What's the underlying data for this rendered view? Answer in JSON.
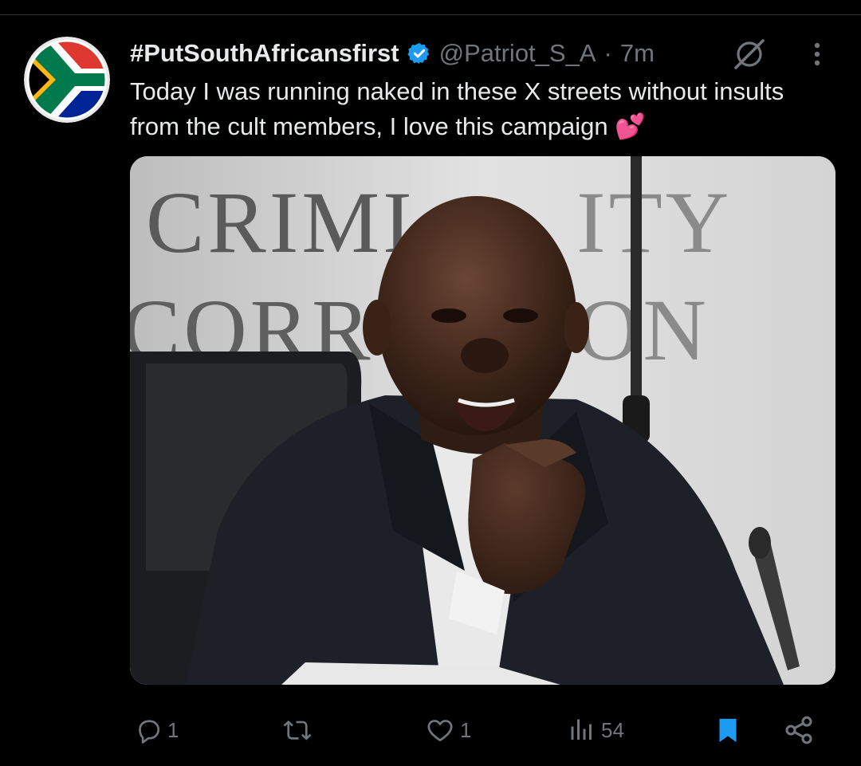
{
  "tweet": {
    "display_name": "#PutSouthAfricansfirst",
    "handle": "@Patriot_S_A",
    "separator": "·",
    "time": "7m",
    "text": "Today I was running naked in these X streets without insults from the cult members, I love this campaign 💕",
    "verified": true,
    "avatar_icon": "south-africa-flag",
    "media_text": {
      "line1": "CRIMI",
      "line1b": "ITY",
      "line2": "CORR",
      "line2b": "ON"
    }
  },
  "actions": {
    "replies": "1",
    "retweets": "",
    "likes": "1",
    "views": "54"
  },
  "colors": {
    "background": "#000000",
    "text": "#e7e9ea",
    "muted": "#71767b",
    "verified": "#1d9bf0",
    "bookmark_active": "#1d9bf0"
  }
}
